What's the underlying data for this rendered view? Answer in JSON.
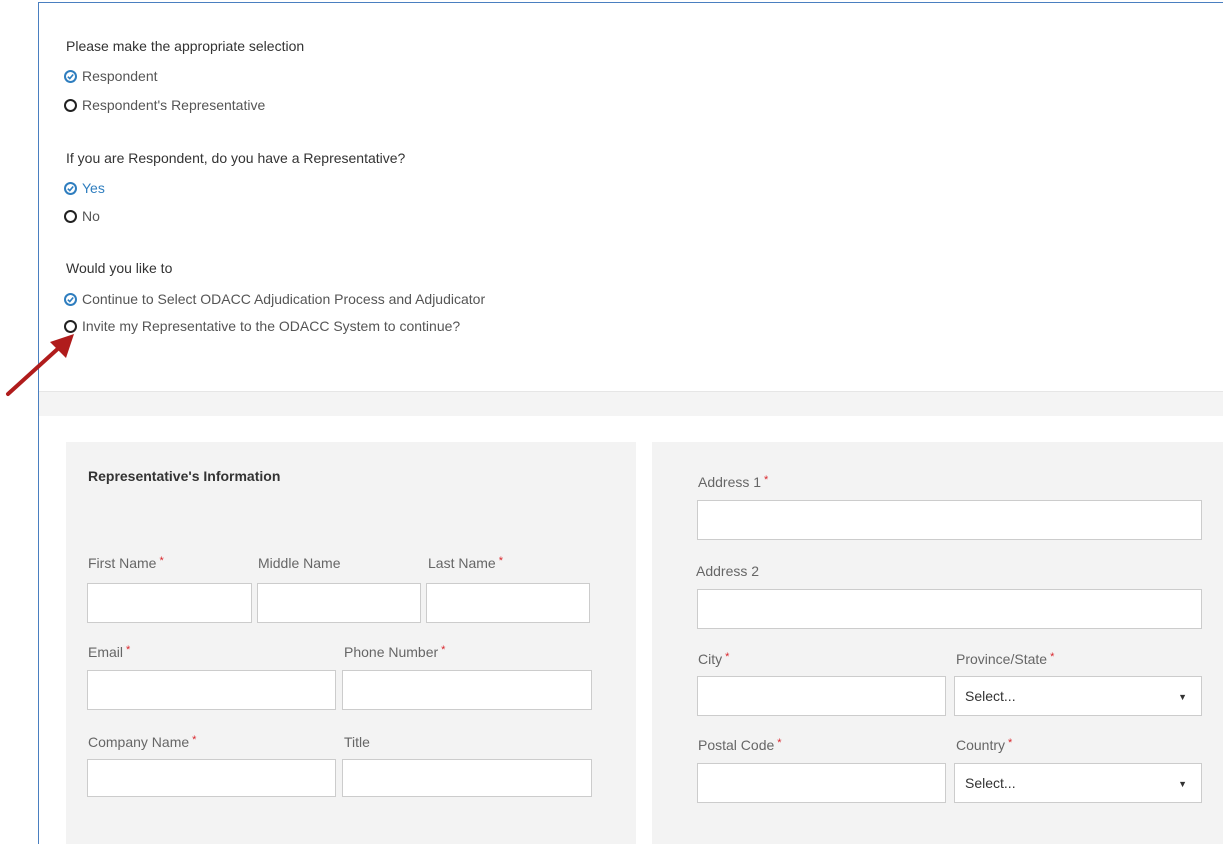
{
  "q1": {
    "prompt": "Please make the appropriate selection",
    "options": [
      {
        "label": "Respondent",
        "selected": true
      },
      {
        "label": "Respondent's Representative",
        "selected": false
      }
    ]
  },
  "q2": {
    "prompt": "If you are Respondent, do you have a Representative?",
    "options": [
      {
        "label": "Yes",
        "selected": true
      },
      {
        "label": "No",
        "selected": false
      }
    ]
  },
  "q3": {
    "prompt": "Would you like to",
    "options": [
      {
        "label": "Continue to Select ODACC Adjudication Process and Adjudicator",
        "selected": true
      },
      {
        "label": "Invite my Representative to the ODACC System to continue?",
        "selected": false
      }
    ]
  },
  "rep": {
    "title": "Representative's Information",
    "first_name": "First Name",
    "middle_name": "Middle Name",
    "last_name": "Last Name",
    "email": "Email",
    "phone": "Phone Number",
    "company": "Company Name",
    "job_title": "Title"
  },
  "address": {
    "address1": "Address 1",
    "address2": "Address 2",
    "city": "City",
    "province": "Province/State",
    "province_value": "Select...",
    "postal": "Postal Code",
    "country": "Country",
    "country_value": "Select..."
  },
  "required_mark": "*",
  "colors": {
    "accent": "#2f7ebf",
    "required": "#d9262c",
    "annotation_arrow": "#b01c1c",
    "panel_bg": "#f3f3f3"
  }
}
